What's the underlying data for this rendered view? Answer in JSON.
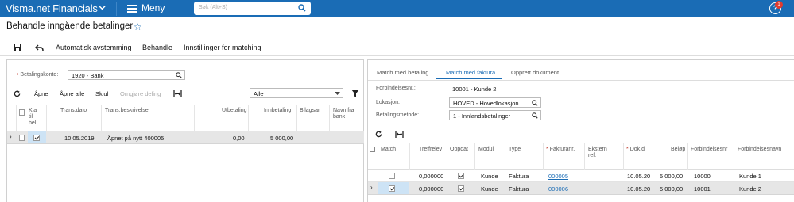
{
  "topbar": {
    "app_name": "Visma.net Financials",
    "menu_label": "Meny",
    "search_placeholder": "Søk (Alt+S)",
    "notification_count": "1"
  },
  "page": {
    "title": "Behandle inngående betalinger"
  },
  "toolbar": {
    "auto_match": "Automatisk avstemming",
    "process": "Behandle",
    "settings": "Innstillinger for matching"
  },
  "left": {
    "account_label": "Betalingskonto:",
    "account_value": "1920 - Bank",
    "buttons": {
      "open": "Åpne",
      "open_all": "Åpne alle",
      "hide": "Skjul",
      "undo_split": "Omgjøre deling"
    },
    "filter_value": "Alle",
    "columns": {
      "ready": "Kla til bel",
      "trans_date": "Trans.dato",
      "trans_desc": "Trans.beskrivelse",
      "payout": "Utbetaling",
      "deposit": "Innbetaling",
      "doc": "Bilagsar",
      "bank_name": "Navn fra bank"
    },
    "rows": [
      {
        "date": "10.05.2019",
        "desc": "Åpnet på nytt 400005",
        "payout": "0,00",
        "deposit": "5 000,00",
        "checked": true
      }
    ]
  },
  "right": {
    "tabs": [
      "Match med betaling",
      "Match med faktura",
      "Opprett dokument"
    ],
    "active_tab": 1,
    "supplier_label": "Forbindelsesnr.:",
    "supplier_value": "10001 - Kunde 2",
    "location_label": "Lokasjon:",
    "location_value": "HOVED - Hovedlokasjon",
    "method_label": "Betalingsmetode:",
    "method_value": "1 - Innlandsbetalinger",
    "columns": {
      "match": "Match",
      "hit": "Treffrelev",
      "update": "Oppdat",
      "module": "Modul",
      "type": "Type",
      "invoice": "Fakturanr.",
      "ext_ref": "Ekstern ref.",
      "doc_date": "Dok.d",
      "amount": "Beløp",
      "bp": "Forbindelsesnr",
      "bp_name": "Forbindelsesnavn"
    },
    "rows": [
      {
        "match": false,
        "hit": "0,000000",
        "update": true,
        "module": "Kunde",
        "type": "Faktura",
        "invoice": "000005",
        "doc_date": "10.05.20",
        "amount": "5 000,00",
        "bp": "10000",
        "bp_name": "Kunde 1"
      },
      {
        "match": true,
        "hit": "0,000000",
        "update": true,
        "module": "Kunde",
        "type": "Faktura",
        "invoice": "000006",
        "doc_date": "10.05.20",
        "amount": "5 000,00",
        "bp": "10001",
        "bp_name": "Kunde 2"
      }
    ]
  }
}
